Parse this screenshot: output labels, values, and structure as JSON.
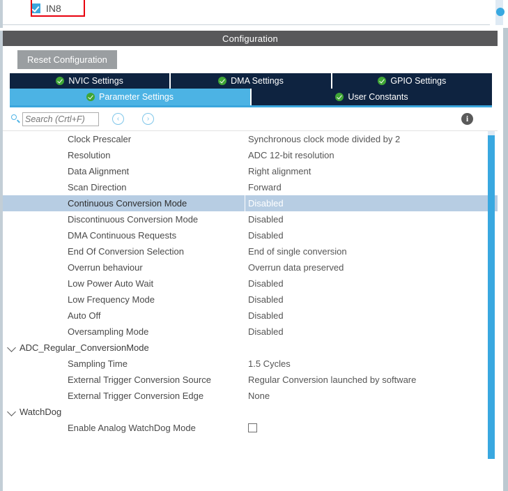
{
  "top_panel": {
    "channel": {
      "label": "IN8",
      "checked": true,
      "highlighted": true,
      "highlight_color": "#e8000d"
    }
  },
  "config": {
    "header_title": "Configuration",
    "reset_button_label": "Reset Configuration",
    "tabs_row1": [
      {
        "label": "NVIC Settings",
        "status": "valid",
        "active": false
      },
      {
        "label": "DMA Settings",
        "status": "valid",
        "active": false
      },
      {
        "label": "GPIO Settings",
        "status": "valid",
        "active": false
      }
    ],
    "tabs_row2": [
      {
        "label": "Parameter Settings",
        "status": "valid",
        "active": true
      },
      {
        "label": "User Constants",
        "status": "valid",
        "active": false
      }
    ],
    "search": {
      "value": "",
      "placeholder": "Search (Crtl+F)",
      "icon": "search-icon",
      "prev_glyph": "‹",
      "next_glyph": "›",
      "info_glyph": "i"
    }
  },
  "parameters": [
    {
      "kind": "row",
      "name": "Clock Prescaler",
      "value": "Synchronous clock mode divided by 2",
      "selected": false
    },
    {
      "kind": "row",
      "name": "Resolution",
      "value": "ADC 12-bit resolution",
      "selected": false
    },
    {
      "kind": "row",
      "name": "Data Alignment",
      "value": "Right alignment",
      "selected": false
    },
    {
      "kind": "row",
      "name": "Scan Direction",
      "value": "Forward",
      "selected": false
    },
    {
      "kind": "row",
      "name": "Continuous Conversion Mode",
      "value": "Disabled",
      "selected": true
    },
    {
      "kind": "row",
      "name": "Discontinuous Conversion Mode",
      "value": "Disabled",
      "selected": false
    },
    {
      "kind": "row",
      "name": "DMA Continuous Requests",
      "value": "Disabled",
      "selected": false
    },
    {
      "kind": "row",
      "name": "End Of Conversion Selection",
      "value": "End of single conversion",
      "selected": false
    },
    {
      "kind": "row",
      "name": "Overrun behaviour",
      "value": "Overrun data preserved",
      "selected": false
    },
    {
      "kind": "row",
      "name": "Low Power Auto Wait",
      "value": "Disabled",
      "selected": false
    },
    {
      "kind": "row",
      "name": "Low Frequency Mode",
      "value": "Disabled",
      "selected": false
    },
    {
      "kind": "row",
      "name": "Auto Off",
      "value": "Disabled",
      "selected": false
    },
    {
      "kind": "row",
      "name": "Oversampling Mode",
      "value": "Disabled",
      "selected": false
    },
    {
      "kind": "group",
      "name": "ADC_Regular_ConversionMode",
      "expanded": true
    },
    {
      "kind": "row",
      "name": "Sampling Time",
      "value": "1.5 Cycles",
      "selected": false
    },
    {
      "kind": "row",
      "name": "External Trigger Conversion Source",
      "value": "Regular Conversion launched by software",
      "selected": false
    },
    {
      "kind": "row",
      "name": "External Trigger Conversion Edge",
      "value": "None",
      "selected": false
    },
    {
      "kind": "group",
      "name": "WatchDog",
      "expanded": true
    },
    {
      "kind": "checkbox-row",
      "name": "Enable Analog WatchDog Mode",
      "checked": false
    }
  ],
  "colors": {
    "header_bar": "#58585a",
    "tab_inactive": "#0e2340",
    "tab_active": "#4cb3e4",
    "selection": "#b7cde3",
    "scrollbar": "#39a8e0",
    "valid_check": "#3fa535",
    "reset_button": "#9a9ea1"
  }
}
